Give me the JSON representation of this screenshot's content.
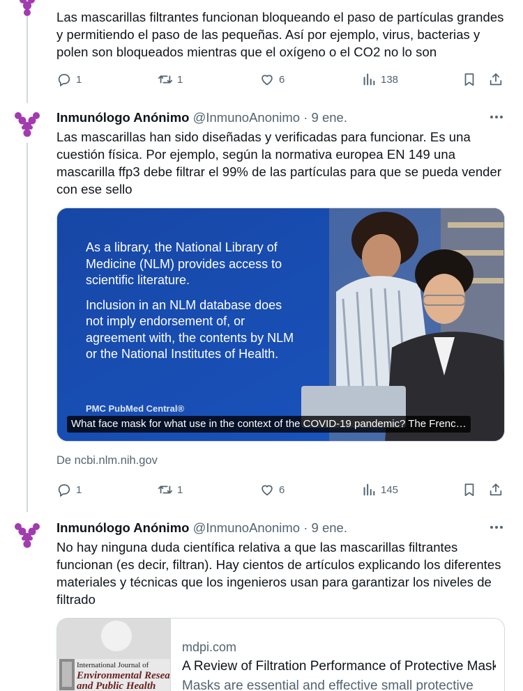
{
  "colors": {
    "text": "#0f1419",
    "muted": "#536471",
    "border": "#cfd9de",
    "media_blue": "#1d4fb0",
    "avatar_purple": "#a23bb0"
  },
  "tweets": [
    {
      "text": "Las mascarillas filtrantes funcionan bloqueando el paso de partículas grandes y permitiendo el paso de las pequeñas. Así por ejemplo, virus, bacterias y polen son bloqueados mientras que el oxígeno o el CO2 no lo son",
      "actions": {
        "replies": "1",
        "retweets": "1",
        "likes": "6",
        "views": "138"
      }
    },
    {
      "name": "Inmunólogo Anónimo",
      "handle": "@InmunoAnonimo",
      "time": "· 9 ene.",
      "text": "Las mascarillas han sido diseñadas y verificadas para funcionar. Es una cuestión física. Por ejemplo, según la normativa europea EN 149 una mascarilla ffp3 debe filtrar el 99% de las partículas para que se pueda vender con ese sello",
      "card": {
        "paragraph1": "As a library, the National Library of Medicine (NLM) provides access to scientific literature.",
        "paragraph2": "Inclusion in an NLM database does not imply endorsement of, or agreement with, the contents by NLM or the National Institutes of Health.",
        "logo": "PMC PubMed Central®",
        "caption": "What face mask for what use in the context of the COVID-19 pandemic? The Frenc…",
        "source": "De ncbi.nlm.nih.gov"
      },
      "actions": {
        "replies": "1",
        "retweets": "1",
        "likes": "6",
        "views": "145"
      }
    },
    {
      "name": "Inmunólogo Anónimo",
      "handle": "@InmunoAnonimo",
      "time": "· 9 ene.",
      "text": "No hay ninguna duda científica relativa a que las mascarillas filtrantes funcionan (es decir, filtran). Hay cientos de artículos explicando los diferentes materiales y técnicas que los ingenieros usan para garantizar los niveles de filtrado",
      "link": {
        "journal_line1": "International Journal of",
        "journal_line2": "Environmental Resea",
        "journal_line3": "and Public Health",
        "domain": "mdpi.com",
        "title": "A Review of Filtration Performance of Protective Masks",
        "description": "Masks are essential and effective small protective"
      }
    }
  ]
}
